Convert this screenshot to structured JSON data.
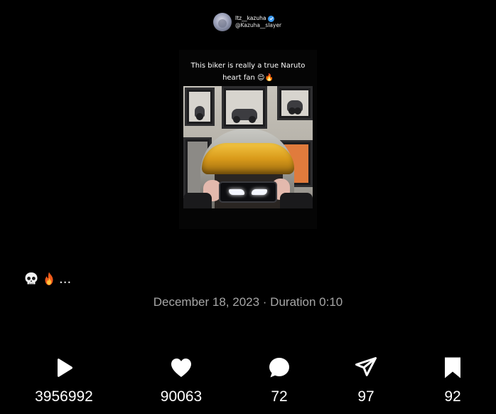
{
  "creator": {
    "name": "Itz__kazuha",
    "handle": "@Kazuha__slayer",
    "verified": true
  },
  "video": {
    "caption": "This biker is really a true Naruto\nheart fan 😌🔥"
  },
  "post": {
    "text_suffix": "...",
    "emojis": [
      "skull-icon",
      "fire-icon"
    ]
  },
  "meta": {
    "date_duration": "December 18, 2023 · Duration 0:10"
  },
  "actions": {
    "views": "3956992",
    "likes": "90063",
    "comments": "72",
    "shares": "97",
    "saves": "92"
  },
  "colors": {
    "background": "#000000",
    "meta_text": "#a6a6a6",
    "verified": "#3897f0"
  }
}
